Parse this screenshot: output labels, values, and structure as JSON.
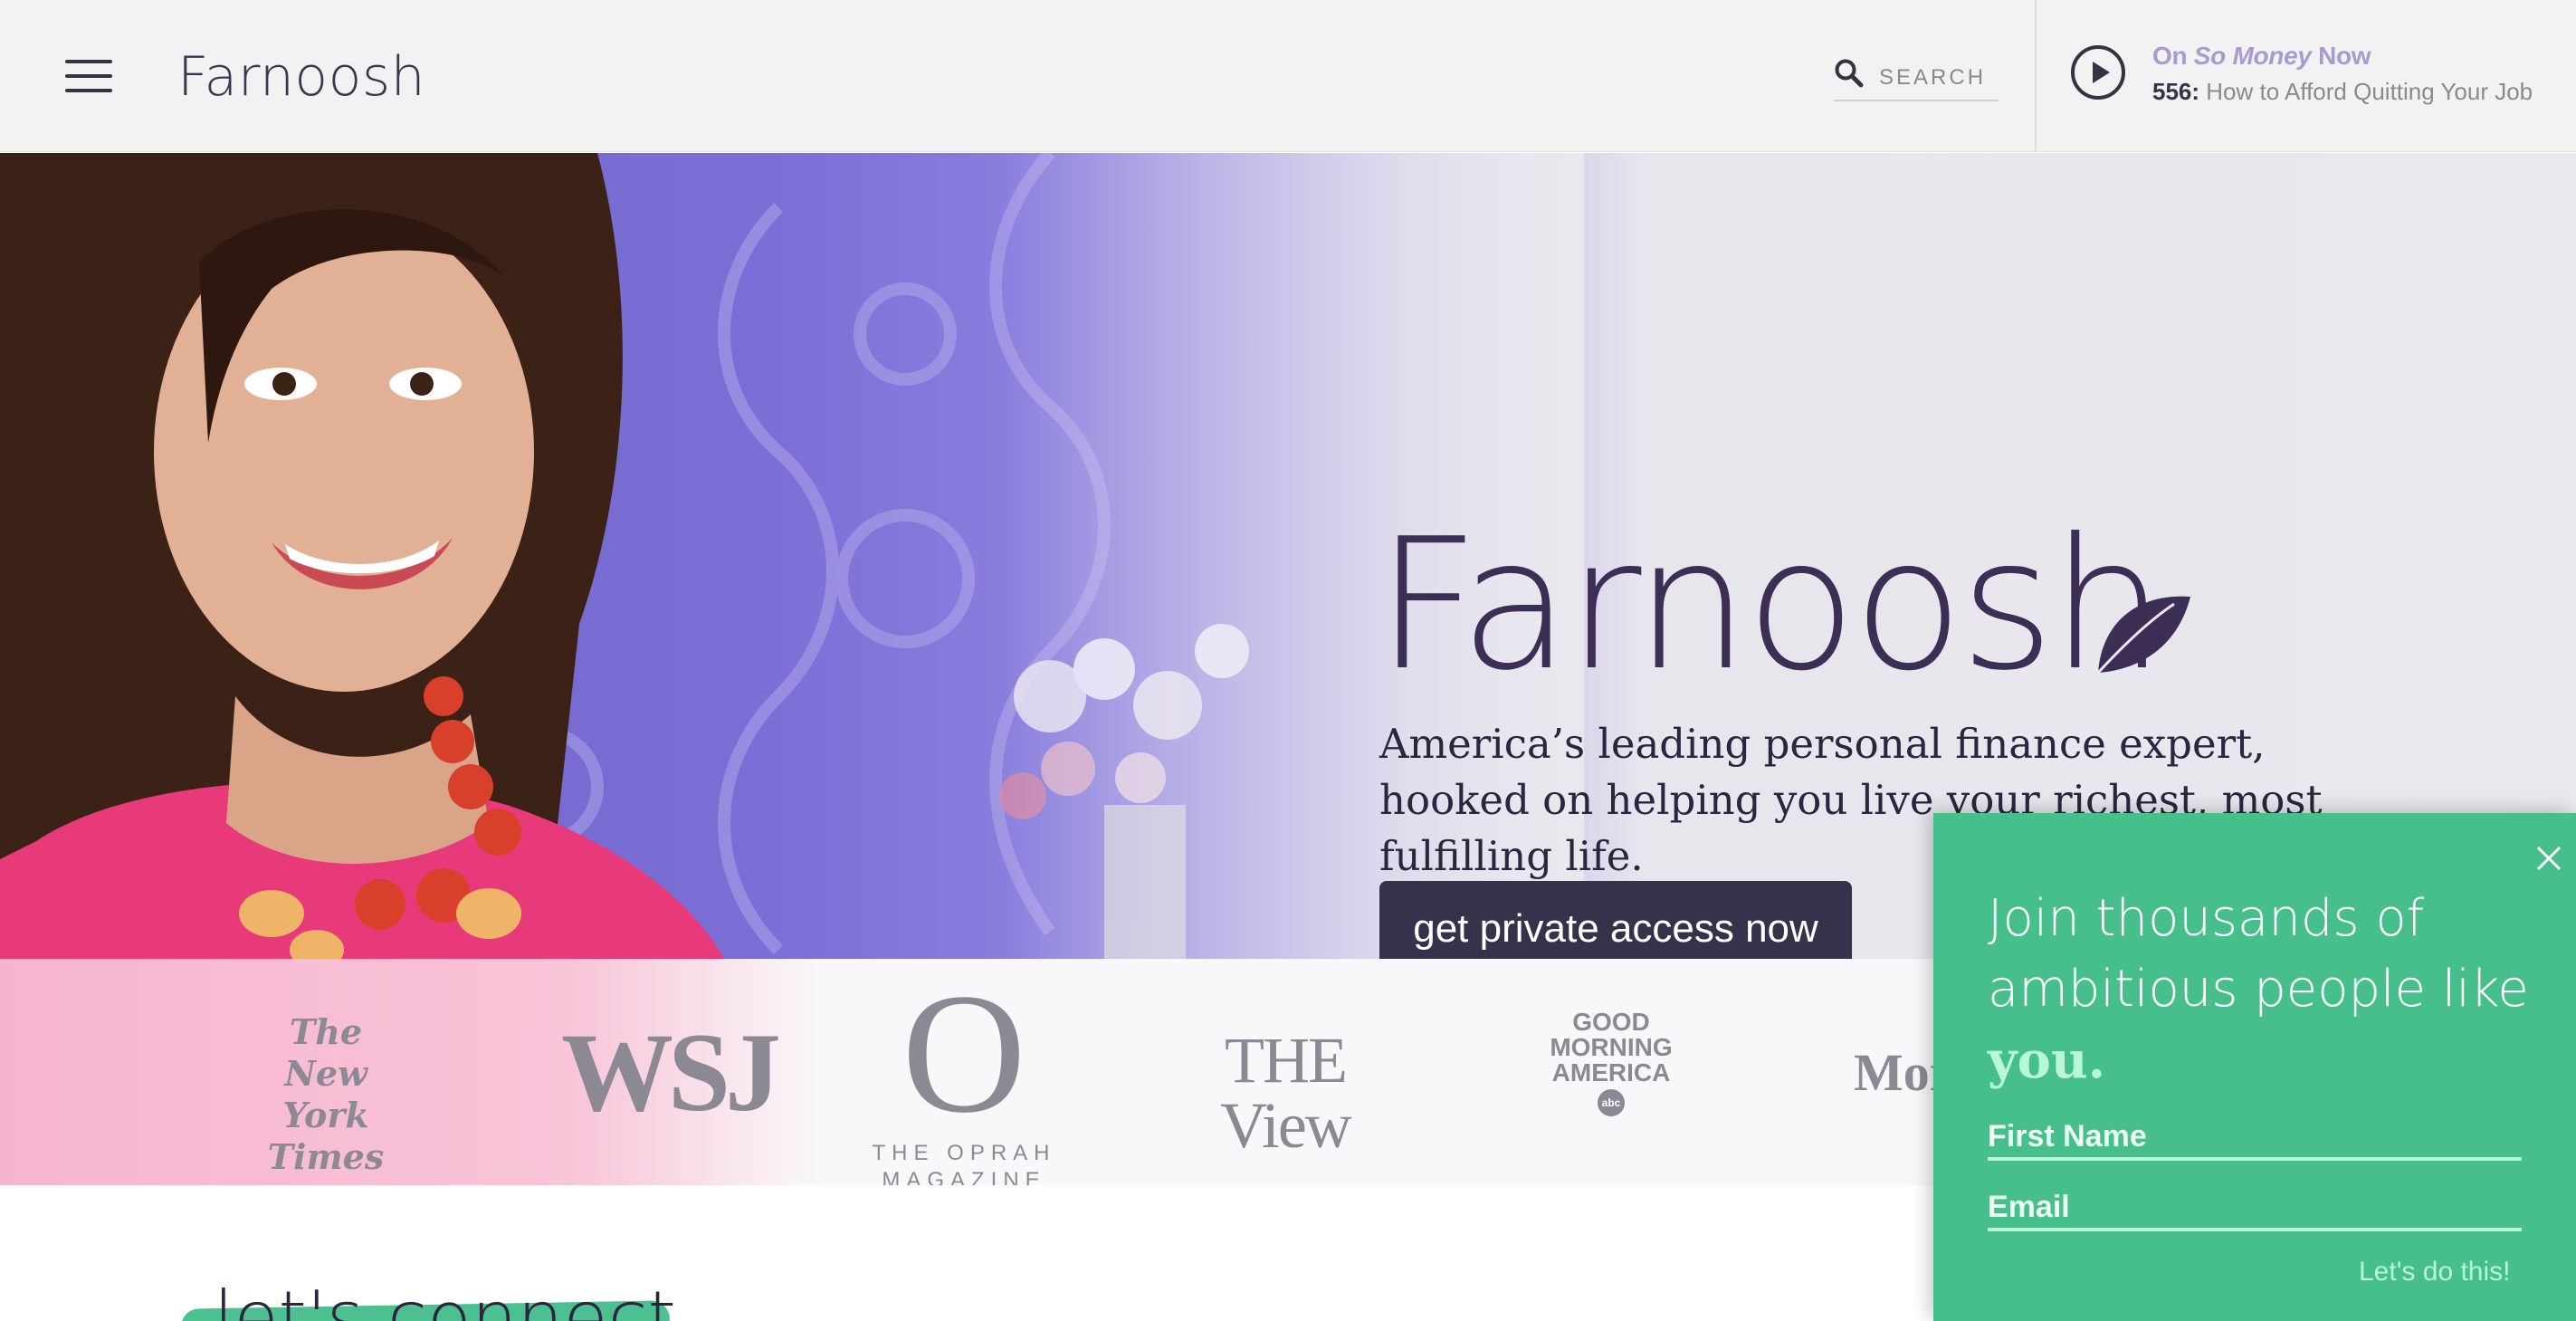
{
  "header": {
    "brand": "Farnoosh",
    "search_label": "SEARCH",
    "now_playing": {
      "prefix": "On",
      "show": "So Money",
      "suffix": "Now",
      "episode_number": "556:",
      "episode_title": "How to Afford Quitting Your Job"
    }
  },
  "hero": {
    "logo": "Farnoosh",
    "tagline": "America’s leading personal finance expert, hooked on helping you live your richest, most fulfilling life.",
    "cta_label": "get private access now"
  },
  "press": {
    "nyt": "The New York Times",
    "wsj": "WSJ",
    "oprah_letter": "O",
    "oprah_sub": "THE OPRAH MAGAZINE",
    "view": "THE View",
    "gma": "GOOD MORNING AMERICA",
    "gma_badge": "abc",
    "money": "Mon"
  },
  "below": {
    "partial_heading": "let's connect"
  },
  "signup": {
    "heading_main": "Join thousands of ambitious people like ",
    "heading_accent": "you.",
    "first_name_placeholder": "First Name",
    "email_placeholder": "Email",
    "submit_label": "Let's do this!"
  },
  "colors": {
    "signup_bg": "#46bf8c",
    "signup_accent": "#b8f7d8",
    "cta_bg": "#35334b",
    "brand_purple": "#3d2e55",
    "now_playing_accent": "#a99ad0"
  },
  "icons": [
    "hamburger-icon",
    "search-icon",
    "play-icon",
    "leaf-icon",
    "close-icon"
  ]
}
